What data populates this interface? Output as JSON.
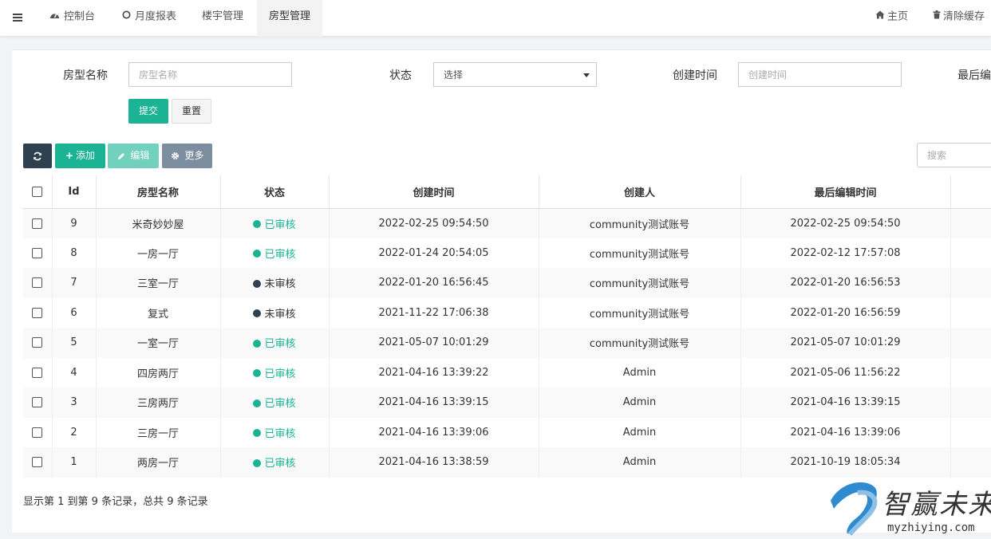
{
  "topnav": {
    "tabs": [
      {
        "label": "控制台"
      },
      {
        "label": "月度报表"
      },
      {
        "label": "楼宇管理"
      },
      {
        "label": "房型管理"
      }
    ],
    "home_label": "主页",
    "clear_cache_label": "清除缓存"
  },
  "filters": {
    "room_type_label": "房型名称",
    "room_type_placeholder": "房型名称",
    "status_label": "状态",
    "status_selected": "选择",
    "created_label": "创建时间",
    "created_placeholder": "创建时间",
    "last_edit_label": "最后编辑",
    "submit_label": "提交",
    "reset_label": "重置"
  },
  "toolbar": {
    "add_label": "添加",
    "edit_label": "编辑",
    "more_label": "更多",
    "search_placeholder": "搜索"
  },
  "table": {
    "headers": [
      "Id",
      "房型名称",
      "状态",
      "创建时间",
      "创建人",
      "最后编辑时间"
    ],
    "rows": [
      {
        "id": "9",
        "name": "米奇妙妙屋",
        "status": "已审核",
        "approved": true,
        "created": "2022-02-25 09:54:50",
        "creator": "community测试账号",
        "edited": "2022-02-25 09:54:50"
      },
      {
        "id": "8",
        "name": "一房一厅",
        "status": "已审核",
        "approved": true,
        "created": "2022-01-24 20:54:05",
        "creator": "community测试账号",
        "edited": "2022-02-12 17:57:08"
      },
      {
        "id": "7",
        "name": "三室一厅",
        "status": "未审核",
        "approved": false,
        "created": "2022-01-20 16:56:45",
        "creator": "community测试账号",
        "edited": "2022-01-20 16:56:53"
      },
      {
        "id": "6",
        "name": "复式",
        "status": "未审核",
        "approved": false,
        "created": "2021-11-22 17:06:38",
        "creator": "community测试账号",
        "edited": "2022-01-20 16:56:59"
      },
      {
        "id": "5",
        "name": "一室一厅",
        "status": "已审核",
        "approved": true,
        "created": "2021-05-07 10:01:29",
        "creator": "community测试账号",
        "edited": "2021-05-07 10:01:29"
      },
      {
        "id": "4",
        "name": "四房两厅",
        "status": "已审核",
        "approved": true,
        "created": "2021-04-16 13:39:22",
        "creator": "Admin",
        "edited": "2021-05-06 11:56:22"
      },
      {
        "id": "3",
        "name": "三房两厅",
        "status": "已审核",
        "approved": true,
        "created": "2021-04-16 13:39:15",
        "creator": "Admin",
        "edited": "2021-04-16 13:39:15"
      },
      {
        "id": "2",
        "name": "三房一厅",
        "status": "已审核",
        "approved": true,
        "created": "2021-04-16 13:39:06",
        "creator": "Admin",
        "edited": "2021-04-16 13:39:06"
      },
      {
        "id": "1",
        "name": "两房一厅",
        "status": "已审核",
        "approved": true,
        "created": "2021-04-16 13:38:59",
        "creator": "Admin",
        "edited": "2021-10-19 18:05:34"
      }
    ]
  },
  "pagination_text": "显示第 1 到第 9 条记录，总共 9 条记录",
  "watermark": {
    "brand": "智赢未来",
    "url": "myzhiying.com"
  },
  "colors": {
    "approved": "#1ab394",
    "pending": "#2f4050",
    "accent": "#1ab394"
  }
}
